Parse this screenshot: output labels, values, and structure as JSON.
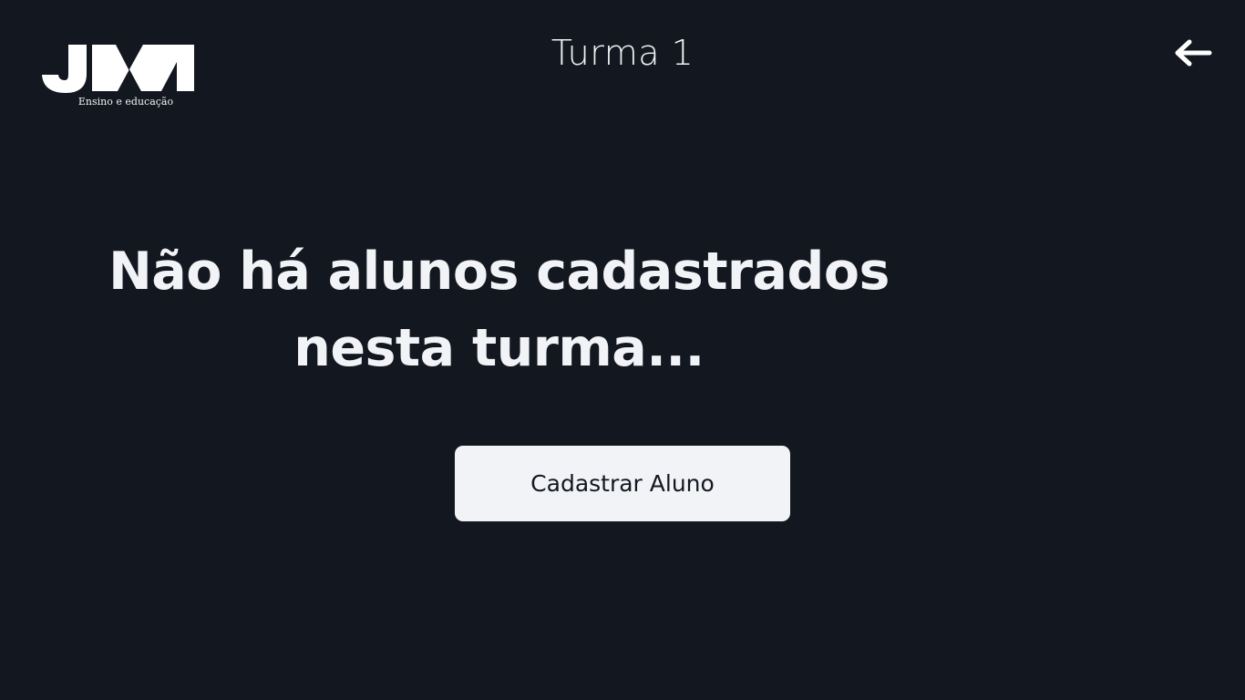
{
  "header": {
    "logo": {
      "mark": "JM",
      "tagline": "Ensino e educação"
    },
    "title": "Turma 1",
    "back_icon": "arrow-left-icon"
  },
  "main": {
    "empty_message": "Não há alunos cadastrados nesta turma...",
    "add_student_label": "Cadastrar Aluno"
  },
  "colors": {
    "background": "#131720",
    "text": "#f2f3f6",
    "button_bg": "#f2f3f7",
    "button_text": "#131720"
  }
}
